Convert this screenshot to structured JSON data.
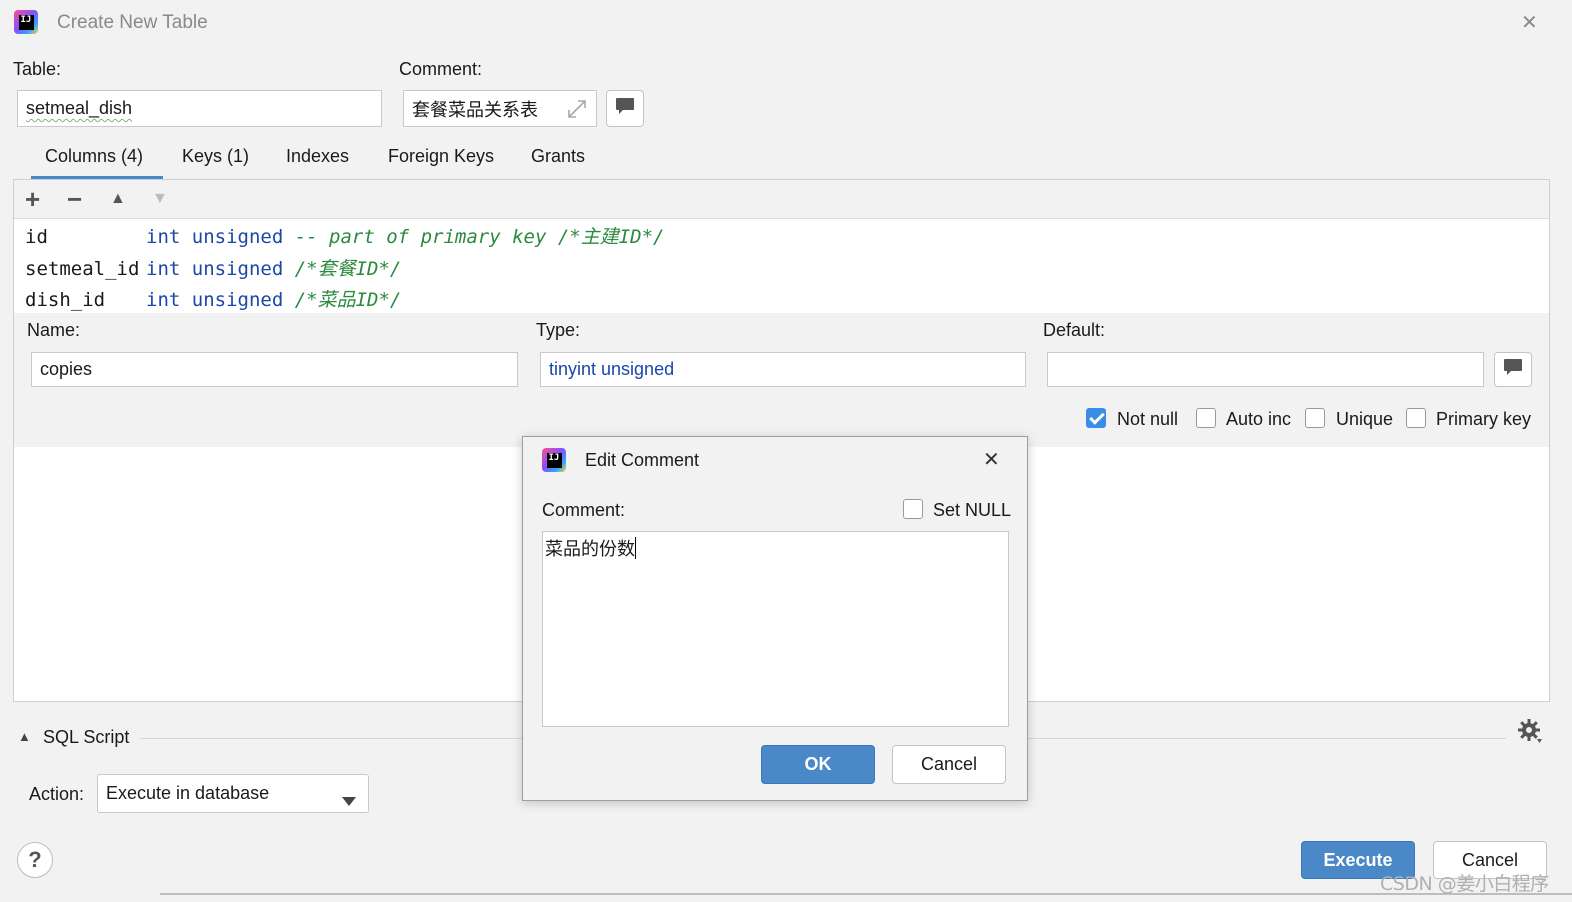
{
  "window": {
    "title": "Create New Table",
    "close_glyph": "✕",
    "logo_text": "IJ"
  },
  "table_field": {
    "label": "Table:",
    "value": "setmeal_dish"
  },
  "comment_field": {
    "label": "Comment:",
    "value": "套餐菜品关系表"
  },
  "tabs": [
    {
      "label": "Columns (4)",
      "active": true
    },
    {
      "label": "Keys (1)"
    },
    {
      "label": "Indexes"
    },
    {
      "label": "Foreign Keys"
    },
    {
      "label": "Grants"
    }
  ],
  "toolbar": {
    "add": "+",
    "remove": "−",
    "up": "▲",
    "down": "▼"
  },
  "columns": [
    {
      "name": "id",
      "type": "int unsigned",
      "comment": "-- part of primary key /*主建ID*/"
    },
    {
      "name": "setmeal_id",
      "type": "int unsigned",
      "comment": "/*套餐ID*/"
    },
    {
      "name": "dish_id",
      "type": "int unsigned",
      "comment": "/*菜品ID*/"
    }
  ],
  "column_editor": {
    "name_label": "Name:",
    "name_value": "copies",
    "type_label": "Type:",
    "type_value": "tinyint unsigned",
    "default_label": "Default:",
    "default_value": "",
    "checkboxes": [
      {
        "label": "Not null",
        "checked": true
      },
      {
        "label": "Auto inc",
        "checked": false
      },
      {
        "label": "Unique",
        "checked": false
      },
      {
        "label": "Primary key",
        "checked": false
      }
    ]
  },
  "sql_section": {
    "label": "SQL Script",
    "action_label": "Action:",
    "action_value": "Execute in database"
  },
  "footer": {
    "help": "?",
    "execute": "Execute",
    "cancel": "Cancel"
  },
  "edit_comment_dialog": {
    "title": "Edit Comment",
    "comment_label": "Comment:",
    "set_null_label": "Set NULL",
    "set_null_checked": false,
    "text": "菜品的份数",
    "ok": "OK",
    "cancel": "Cancel"
  },
  "watermark": "CSDN @姜小白程序",
  "colors": {
    "accent": "#4a88c7",
    "keyword": "#1a47a8",
    "comment": "#2b8a3e",
    "background": "#f2f2f2"
  }
}
